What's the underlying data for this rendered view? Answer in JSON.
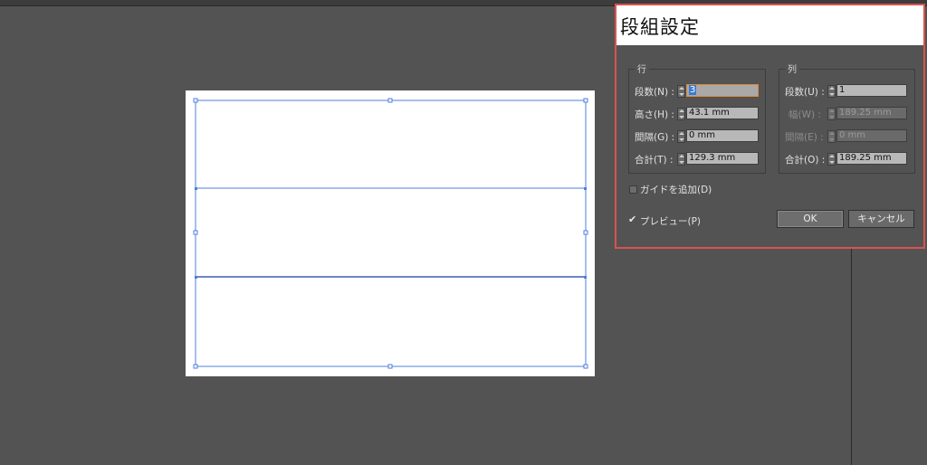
{
  "dialog": {
    "title": "段組設定",
    "rows_group": {
      "label": "行",
      "count": {
        "label": "段数(N) :",
        "value": "3"
      },
      "height": {
        "label": "高さ(H) :",
        "value": "43.1 mm"
      },
      "gutter": {
        "label": "間隔(G) :",
        "value": "0 mm"
      },
      "total": {
        "label": "合計(T) :",
        "value": "129.3 mm"
      }
    },
    "cols_group": {
      "label": "列",
      "count": {
        "label": "段数(U) :",
        "value": "1"
      },
      "width": {
        "label": "幅(W) :",
        "value": "189.25 mm"
      },
      "gutter": {
        "label": "間隔(E) :",
        "value": "0 mm"
      },
      "total": {
        "label": "合計(O) :",
        "value": "189.25 mm"
      }
    },
    "add_guides": {
      "label": "ガイドを追加(D)",
      "checked": false
    },
    "preview": {
      "label": "プレビュー(P)",
      "checked": true
    },
    "ok_label": "OK",
    "cancel_label": "キャンセル"
  },
  "colors": {
    "dialog_border": "#d9534f",
    "guide": "#4f7fd8",
    "focus": "#e0892f"
  }
}
